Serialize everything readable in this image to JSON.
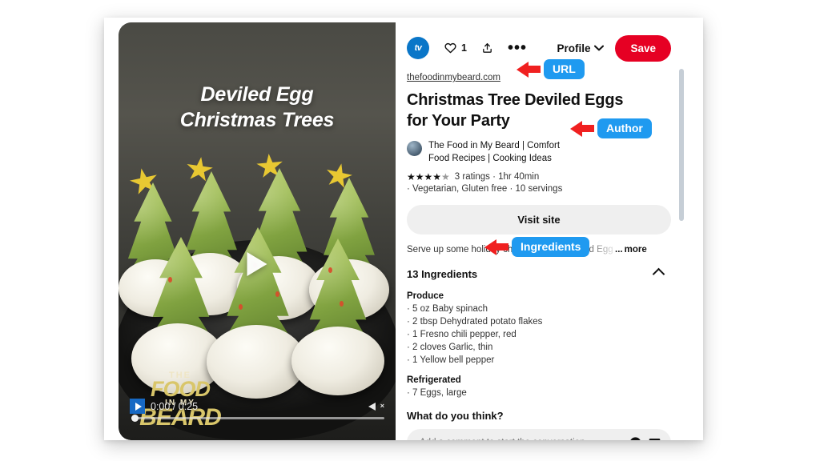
{
  "video": {
    "overlay_title_line1": "Deviled Egg",
    "overlay_title_line2": "Christmas Trees",
    "watermark_line1": "THE",
    "watermark_line2": "FOOD",
    "watermark_line3": "IN MY",
    "watermark_line4": "BEARD",
    "current_time": "0:00",
    "duration": "0:25",
    "time_display": "0:00 / 0:25",
    "play_icon": "play-icon",
    "mute_icon": "speaker-muted-icon",
    "big_play_icon": "play-triangle-icon"
  },
  "header": {
    "avatar_text": "tv",
    "heart_icon": "heart-icon",
    "like_count": "1",
    "share_icon": "share-upload-icon",
    "more_icon": "ellipsis-icon",
    "profile_label": "Profile",
    "profile_chevron": "chevron-down-icon",
    "save_label": "Save",
    "save_color": "#e60023"
  },
  "pin": {
    "domain": "thefoodinmybeard.com",
    "title": "Christmas Tree Deviled Eggs for Your Party",
    "author": "The Food in My Beard | Comfort Food Recipes | Cooking Ideas",
    "stars_filled": 4,
    "stars_total": 5,
    "ratings_text": "3 ratings",
    "time_text": "1hr 40min",
    "diet_text": "Vegetarian, Gluten free",
    "servings_text": "10 servings",
    "meta_line1": "3 ratings  · 1hr 40min",
    "meta_line2": "· Vegetarian, Gluten free · 10 servings",
    "visit_label": "Visit site",
    "description": "Serve up some holiday cheer with our Deviled Egg Christmas Tre",
    "description_ellipsis": "...",
    "more_label": "more"
  },
  "ingredients": {
    "heading": "13 Ingredients",
    "collapse_icon": "chevron-up-icon",
    "sections": [
      {
        "category": "Produce",
        "items": [
          "· 5 oz Baby spinach",
          "· 2 tbsp Dehydrated potato flakes",
          "· 1 Fresno chili pepper, red",
          "· 2 cloves Garlic, thin",
          "· 1 Yellow bell pepper"
        ]
      },
      {
        "category": "Refrigerated",
        "items": [
          "· 7 Eggs, large"
        ]
      }
    ]
  },
  "comments": {
    "heading": "What do you think?",
    "placeholder": "Add a comment to start the conversation",
    "emoji_icon": "emoji-smiley-icon",
    "image_icon": "image-attach-icon"
  },
  "annotations": {
    "badge_color": "#1f9af0",
    "arrow_color": "#f02020",
    "items": [
      {
        "label": "URL"
      },
      {
        "label": "Author"
      },
      {
        "label": "Ingredients"
      }
    ]
  }
}
